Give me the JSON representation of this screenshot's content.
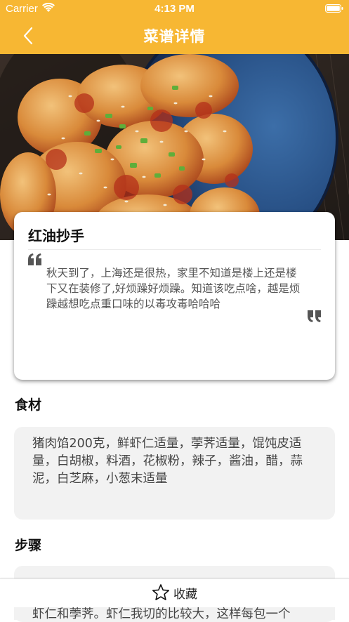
{
  "status_bar": {
    "carrier": "Carrier",
    "time": "4:13 PM",
    "icons": [
      "wifi-icon",
      "battery-icon"
    ]
  },
  "nav": {
    "title": "菜谱详情",
    "back_icon": "chevron-left-icon"
  },
  "theme": {
    "accent": "#f7b733",
    "panel_bg": "#f2f2f2"
  },
  "recipe": {
    "name": "红油抄手",
    "description": "秋天到了，上海还是很热，家里不知道是楼上还是楼下又在装修了,好烦躁好烦躁。知道该吃点啥，越是烦躁越想吃点重口味的以毒攻毒哈哈哈"
  },
  "ingredients": {
    "title": "食材",
    "text": "猪肉馅200克，鲜虾仁适量，荸荠适量，馄饨皮适量，白胡椒，料酒，花椒粉，辣子，酱油，醋，蒜泥，白芝麻，小葱末适量"
  },
  "steps": {
    "title": "步骤",
    "partial_text_visible": "虾仁和荸荠。虾仁我切的比较大，这样每包一个"
  },
  "bottom_bar": {
    "favorite_label": "收藏",
    "favorite_icon": "star-outline-icon"
  }
}
